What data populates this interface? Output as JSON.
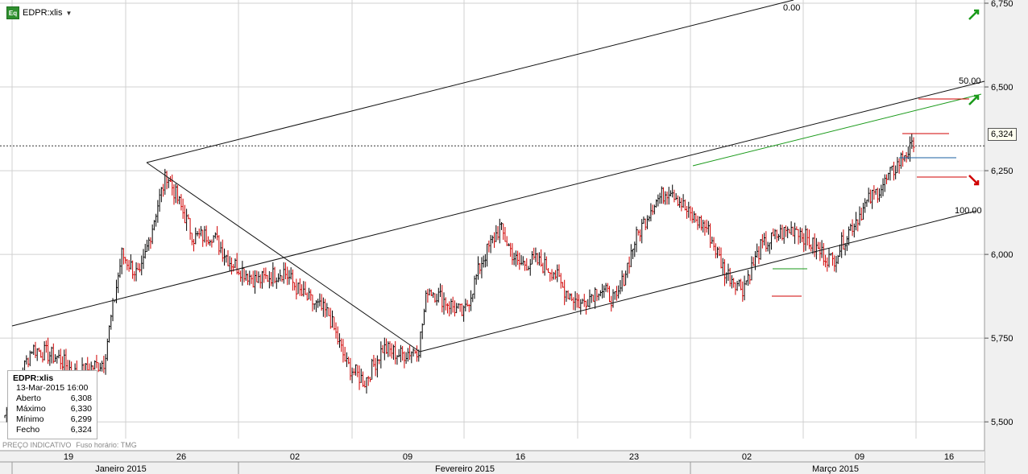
{
  "symbol": "EDPR:xlis",
  "chart_data": {
    "type": "candlestick",
    "ylim": [
      5.45,
      6.75
    ],
    "y_ticks": [
      "6,750",
      "6,500",
      "6,250",
      "6,000",
      "5,750",
      "5,500"
    ],
    "x_ticks": [
      "19",
      "26",
      "02",
      "09",
      "16",
      "23",
      "02",
      "09",
      "16"
    ],
    "months": [
      "Janeiro 2015",
      "Fevereiro 2015",
      "Março 2015"
    ],
    "last_price": "6,324",
    "fib_labels": [
      "0.00",
      "50.00",
      "100.00"
    ],
    "close_path": [
      [
        0,
        5.52
      ],
      [
        3,
        5.72
      ],
      [
        6,
        5.69
      ],
      [
        8,
        5.64
      ],
      [
        11,
        5.68
      ],
      [
        13,
        6.0
      ],
      [
        15,
        5.93
      ],
      [
        17,
        6.15
      ],
      [
        18,
        6.24
      ],
      [
        21,
        6.05
      ],
      [
        23,
        6.06
      ],
      [
        25,
        5.98
      ],
      [
        28,
        5.92
      ],
      [
        31,
        5.95
      ],
      [
        33,
        5.88
      ],
      [
        36,
        5.82
      ],
      [
        38,
        5.67
      ],
      [
        40,
        5.62
      ],
      [
        42,
        5.72
      ],
      [
        44,
        5.7
      ],
      [
        46,
        5.72
      ],
      [
        47,
        5.9
      ],
      [
        49,
        5.86
      ],
      [
        51,
        5.82
      ],
      [
        53,
        5.98
      ],
      [
        55,
        6.08
      ],
      [
        57,
        5.97
      ],
      [
        59,
        5.98
      ],
      [
        61,
        5.95
      ],
      [
        62,
        5.9
      ],
      [
        64,
        5.85
      ],
      [
        66,
        5.9
      ],
      [
        68,
        5.86
      ],
      [
        70,
        6.04
      ],
      [
        72,
        6.15
      ],
      [
        74,
        6.2
      ],
      [
        76,
        6.12
      ],
      [
        78,
        6.08
      ],
      [
        80,
        5.95
      ],
      [
        82,
        5.9
      ],
      [
        84,
        6.02
      ],
      [
        86,
        6.06
      ],
      [
        88,
        6.08
      ],
      [
        90,
        6.02
      ],
      [
        92,
        5.98
      ],
      [
        94,
        6.08
      ],
      [
        96,
        6.16
      ],
      [
        98,
        6.22
      ],
      [
        100,
        6.3
      ],
      [
        101,
        6.32
      ]
    ]
  },
  "info": {
    "title": "EDPR:xlis",
    "date_time": "13-Mar-2015 16:00",
    "rows": [
      {
        "label": "Aberto",
        "value": "6,308"
      },
      {
        "label": "Máximo",
        "value": "6,330"
      },
      {
        "label": "Mínimo",
        "value": "6,299"
      },
      {
        "label": "Fecho",
        "value": "6,324"
      }
    ]
  },
  "footer": {
    "note": "PREÇO INDICATIVO",
    "tz": "Fuso horário: TMG"
  },
  "colors": {
    "up": "#000000",
    "down": "#d00000",
    "green": "#1a9a1a",
    "grid": "#d0d0d0"
  }
}
